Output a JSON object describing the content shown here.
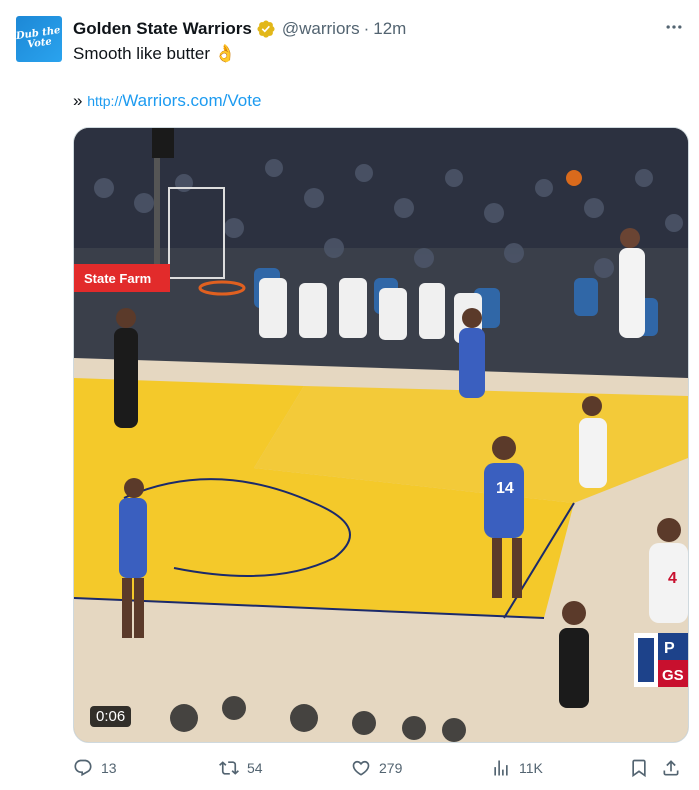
{
  "author": {
    "name": "Golden State Warriors",
    "handle": "@warriors",
    "separator": "·",
    "time": "12m",
    "avatar_text": "Dub the Vote",
    "verified": true
  },
  "tweet": {
    "text": "Smooth like butter 👌",
    "link_prefix": "»",
    "link_protocol": "http://",
    "link_text": "Warriors.com/Vote"
  },
  "media": {
    "duration": "0:06",
    "arena_sign": "State Farm",
    "jersey_numbers": [
      "14",
      "4"
    ],
    "scorebug_letters": [
      "P",
      "GS"
    ]
  },
  "actions": {
    "replies": "13",
    "retweets": "54",
    "likes": "279",
    "views": "11K"
  },
  "colors": {
    "accent": "#1d9bf0",
    "muted": "#536471",
    "gold_badge": "#e2b719"
  }
}
